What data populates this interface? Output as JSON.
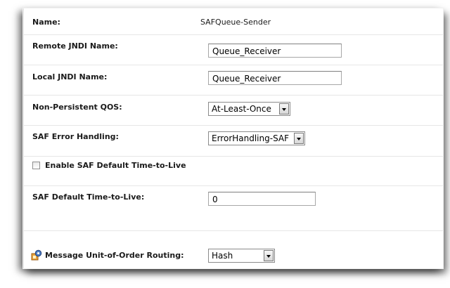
{
  "fields": {
    "name": {
      "label": "Name:",
      "value": "SAFQueue-Sender"
    },
    "remote_jndi": {
      "label": "Remote JNDI Name:",
      "value": "Queue_Receiver"
    },
    "local_jndi": {
      "label": "Local JNDI Name:",
      "value": "Queue_Receiver"
    },
    "non_persistent_qos": {
      "label": "Non-Persistent QOS:",
      "selected": "At-Least-Once"
    },
    "saf_error_handling": {
      "label": "SAF Error Handling:",
      "selected": "ErrorHandling-SAF"
    },
    "enable_ttl": {
      "label": "Enable SAF Default Time-to-Live",
      "checked": false
    },
    "default_ttl": {
      "label": "SAF Default Time-to-Live:",
      "value": "0"
    },
    "unit_of_order_routing": {
      "label": "Message Unit-of-Order Routing:",
      "selected": "Hash",
      "icon": "gear-lock-icon"
    }
  },
  "colors": {
    "label_text": "#1a1a1a",
    "row_divider": "#e6e6e6",
    "input_border": "#a7a7a7",
    "icon_orange": "#e8a33c",
    "icon_blue": "#4f7fc4"
  }
}
